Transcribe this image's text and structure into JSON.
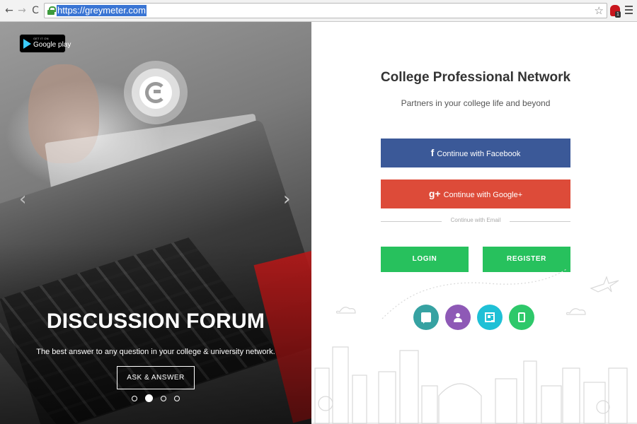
{
  "browser": {
    "url": "https://greymeter.com",
    "back_icon": "←",
    "forward_icon": "→",
    "reload_icon": "C",
    "star_icon": "☆",
    "extension_badge": "1"
  },
  "hero": {
    "gplay_small": "GET IT ON",
    "gplay_label": "Google play",
    "title": "DISCUSSION FORUM",
    "subtitle": "The best answer to any question in your college & university network.",
    "cta_label": "ASK & ANSWER",
    "arrow_left": "‹",
    "arrow_right": "›",
    "slide_count": 4,
    "active_slide": 2
  },
  "panel": {
    "title": "College Professional Network",
    "tagline": "Partners in your college life and beyond",
    "facebook_icon": "f",
    "facebook_label": "Continue with Facebook",
    "google_icon": "g+",
    "google_label": "Continue with Google+",
    "divider_label": "Continue with Email",
    "login_label": "LOGIN",
    "register_label": "REGISTER",
    "features": [
      "chat-icon",
      "group-icon",
      "news-icon",
      "mobile-icon"
    ]
  },
  "colors": {
    "facebook": "#3b5998",
    "google": "#dd4b39",
    "green": "#27c15d",
    "feature_teal": "#36a2a2",
    "feature_purple": "#8e59b6",
    "feature_cyan": "#1fc0d6",
    "feature_green": "#2ec86a"
  }
}
